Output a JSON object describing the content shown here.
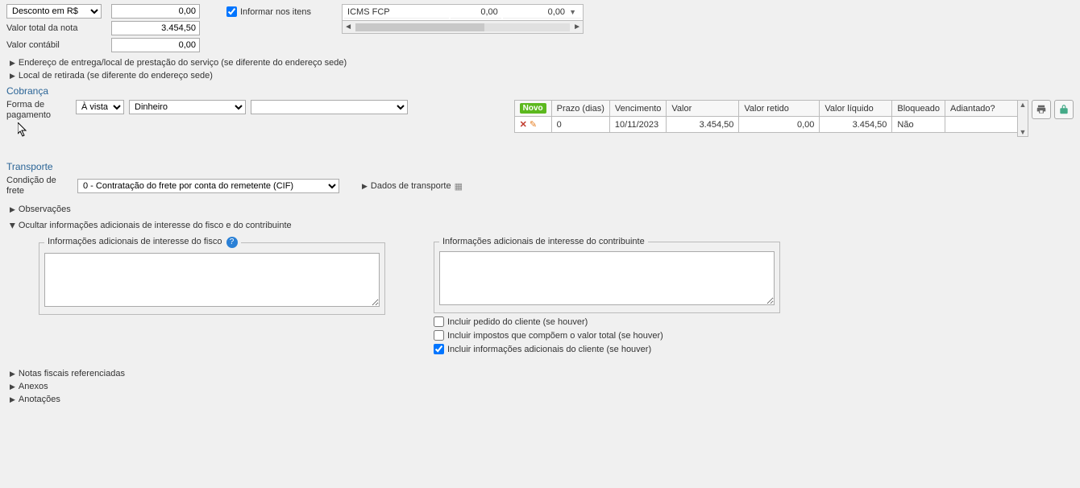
{
  "top": {
    "desconto_select": "Desconto em R$",
    "desconto_value": "0,00",
    "informar_itens_label": "Informar nos itens",
    "informar_itens_checked": true,
    "valor_total_label": "Valor total da nota",
    "valor_total_value": "3.454,50",
    "valor_contabil_label": "Valor contábil",
    "valor_contabil_value": "0,00",
    "mini_table_row_label": "ICMS FCP",
    "mini_table_val1": "0,00",
    "mini_table_val2": "0,00"
  },
  "expanders": {
    "endereco": "Endereço de entrega/local de prestação do serviço (se diferente do endereço sede)",
    "local_retirada": "Local de retirada (se diferente do endereço sede)",
    "observacoes": "Observações",
    "ocultar_info": "Ocultar informações adicionais de interesse do fisco e do contribuinte",
    "notas_ref": "Notas fiscais referenciadas",
    "anexos": "Anexos",
    "anotacoes": "Anotações",
    "dados_transporte": "Dados de transporte"
  },
  "cobranca": {
    "title": "Cobrança",
    "forma_label": "Forma de pagamento",
    "forma_sel1": "À vista",
    "forma_sel2": "Dinheiro",
    "forma_sel3": "",
    "novo": "Novo",
    "headers": {
      "prazo": "Prazo (dias)",
      "vencimento": "Vencimento",
      "valor": "Valor",
      "valor_retido": "Valor retido",
      "valor_liquido": "Valor líquido",
      "bloqueado": "Bloqueado",
      "adiantado": "Adiantado?"
    },
    "row": {
      "prazo": "0",
      "vencimento": "10/11/2023",
      "valor": "3.454,50",
      "valor_retido": "0,00",
      "valor_liquido": "3.454,50",
      "bloqueado": "Não",
      "adiantado": ""
    }
  },
  "transporte": {
    "title": "Transporte",
    "condicao_label": "Condição de frete",
    "condicao_value": "0 - Contratação do frete por conta do remetente (CIF)"
  },
  "info": {
    "fisco_legend": "Informações adicionais de interesse do fisco",
    "contrib_legend": "Informações adicionais de interesse do contribuinte",
    "chk_pedido": "Incluir pedido do cliente (se houver)",
    "chk_impostos": "Incluir impostos que compõem o valor total (se houver)",
    "chk_info_cliente": "Incluir informações adicionais do cliente (se houver)"
  }
}
